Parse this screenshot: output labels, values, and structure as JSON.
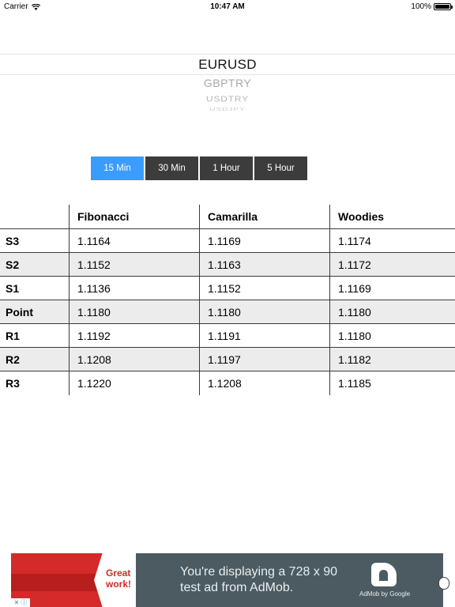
{
  "status_bar": {
    "carrier": "Carrier",
    "time": "10:47 AM",
    "battery": "100%"
  },
  "picker": {
    "items": [
      "EURUSD",
      "GBPTRY",
      "USDTRY",
      "USDJPY"
    ]
  },
  "segments": [
    {
      "label": "15 Min",
      "active": true
    },
    {
      "label": "30 Min",
      "active": false
    },
    {
      "label": "1 Hour",
      "active": false
    },
    {
      "label": "5 Hour",
      "active": false
    }
  ],
  "table": {
    "columns": [
      "",
      "Fibonacci",
      "Camarilla",
      "Woodies"
    ],
    "rows": [
      [
        "S3",
        "1.1164",
        "1.1169",
        "1.1174"
      ],
      [
        "S2",
        "1.1152",
        "1.1163",
        "1.1172"
      ],
      [
        "S1",
        "1.1136",
        "1.1152",
        "1.1169"
      ],
      [
        "Point",
        "1.1180",
        "1.1180",
        "1.1180"
      ],
      [
        "R1",
        "1.1192",
        "1.1191",
        "1.1180"
      ],
      [
        "R2",
        "1.1208",
        "1.1197",
        "1.1182"
      ],
      [
        "R3",
        "1.1220",
        "1.1208",
        "1.1185"
      ]
    ]
  },
  "ad": {
    "badge": "Great work!",
    "line1": "You're displaying a 728 x 90",
    "line2": "test ad from AdMob.",
    "brand": "AdMob by Google",
    "accent": "#d42a2a",
    "background": "#4b5b61"
  },
  "colors": {
    "active_segment": "#3a9cff",
    "segment": "#3c3c3c",
    "alt_row": "#ececec"
  }
}
